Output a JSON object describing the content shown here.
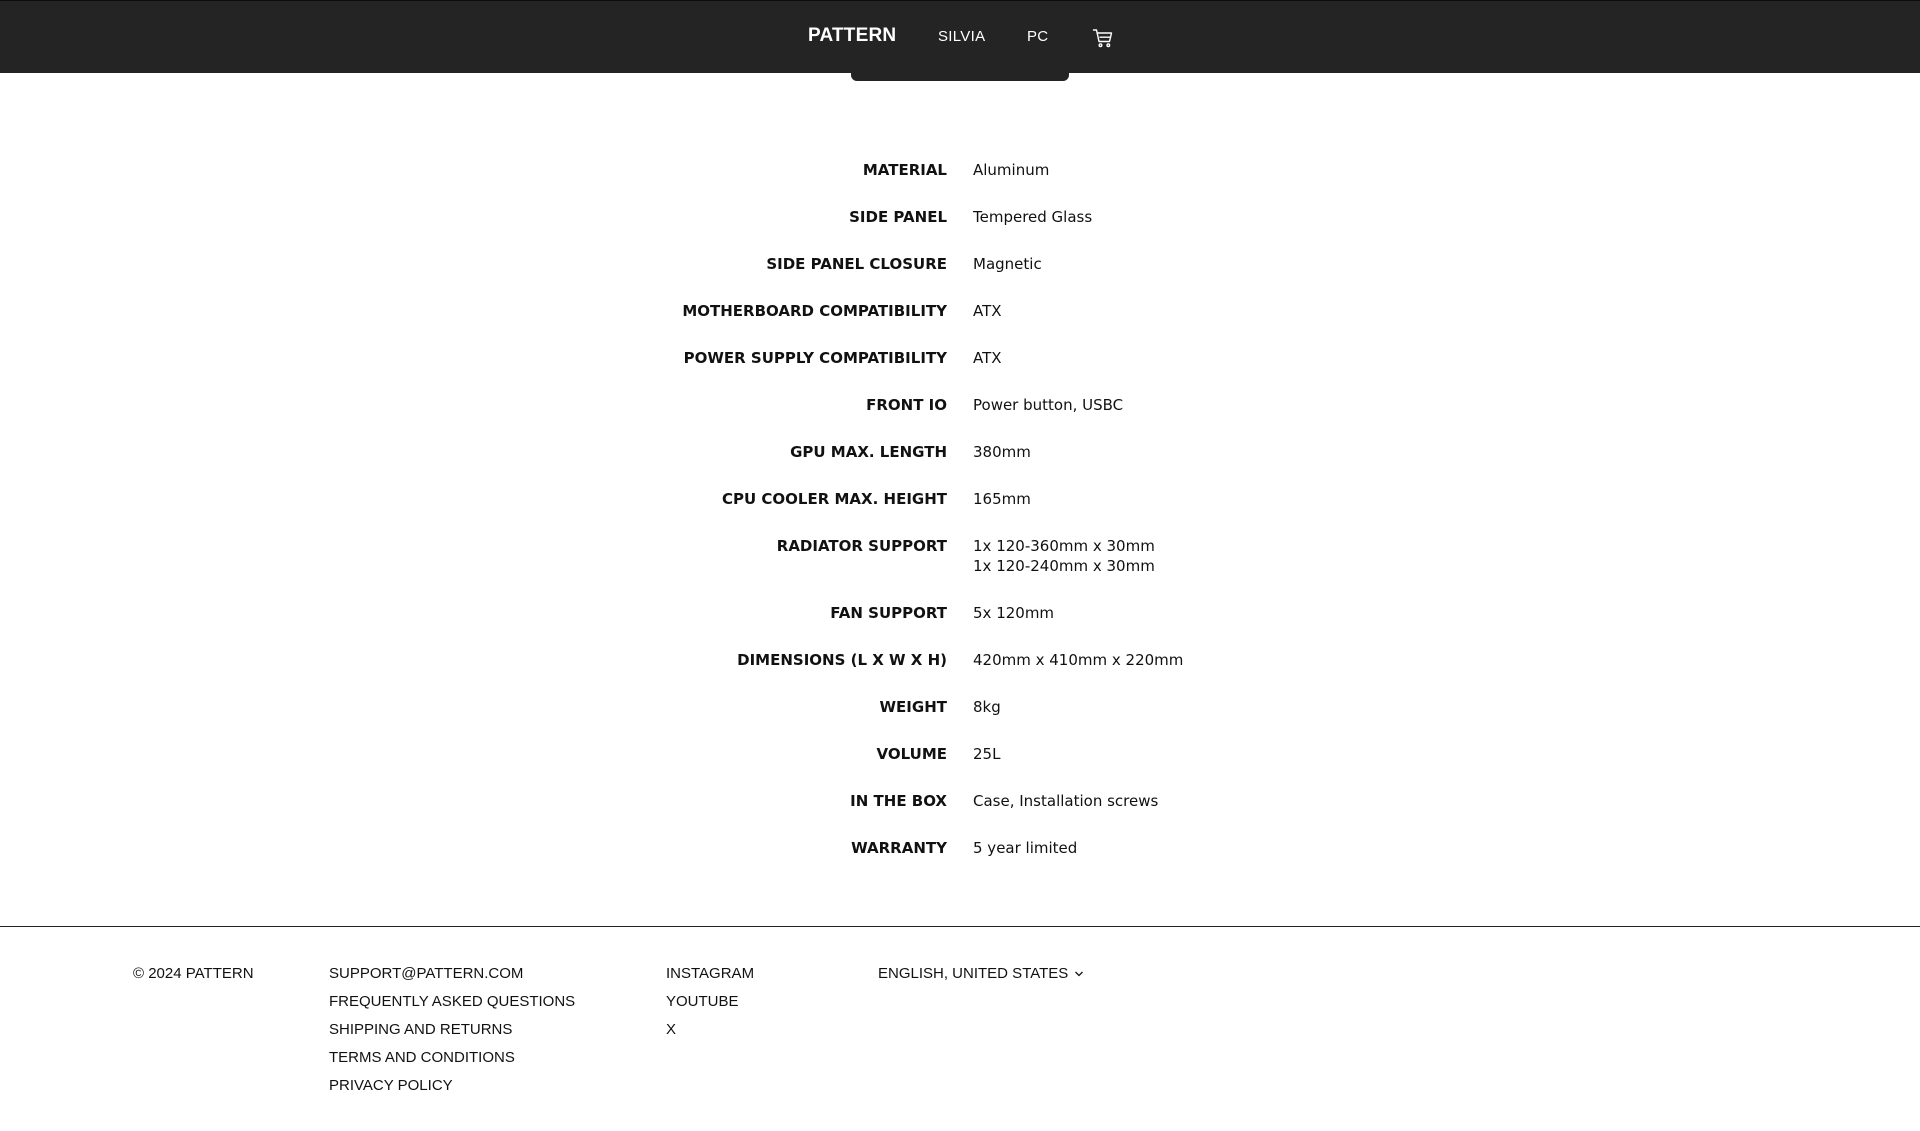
{
  "nav": {
    "brand": "PATTERN",
    "links": [
      "SILVIA",
      "PC"
    ],
    "cart_icon": "cart-icon"
  },
  "specs": [
    {
      "label": "MATERIAL",
      "value": "Aluminum"
    },
    {
      "label": "SIDE PANEL",
      "value": "Tempered Glass"
    },
    {
      "label": "SIDE PANEL CLOSURE",
      "value": "Magnetic"
    },
    {
      "label": "MOTHERBOARD COMPATIBILITY",
      "value": "ATX"
    },
    {
      "label": "POWER SUPPLY COMPATIBILITY",
      "value": "ATX"
    },
    {
      "label": "FRONT IO",
      "value": "Power button, USBC"
    },
    {
      "label": "GPU MAX. LENGTH",
      "value": "380mm"
    },
    {
      "label": "CPU COOLER MAX. HEIGHT",
      "value": "165mm"
    },
    {
      "label": "RADIATOR SUPPORT",
      "value": "1x 120-360mm x 30mm\n1x 120-240mm x 30mm"
    },
    {
      "label": "FAN SUPPORT",
      "value": "5x 120mm"
    },
    {
      "label": "DIMENSIONS (L X W X H)",
      "value": "420mm x 410mm x 220mm"
    },
    {
      "label": "WEIGHT",
      "value": "8kg"
    },
    {
      "label": "VOLUME",
      "value": "25L"
    },
    {
      "label": "IN THE BOX",
      "value": "Case, Installation screws"
    },
    {
      "label": "WARRANTY",
      "value": "5 year limited"
    }
  ],
  "footer": {
    "copyright": "© 2024 PATTERN",
    "support_links": [
      "SUPPORT@PATTERN.COM",
      "FREQUENTLY ASKED QUESTIONS",
      "SHIPPING AND RETURNS",
      "TERMS AND CONDITIONS",
      "PRIVACY POLICY"
    ],
    "social_links": [
      "INSTAGRAM",
      "YOUTUBE",
      "X"
    ],
    "language": "ENGLISH, UNITED STATES",
    "language_icon": "chevron-down-icon"
  }
}
